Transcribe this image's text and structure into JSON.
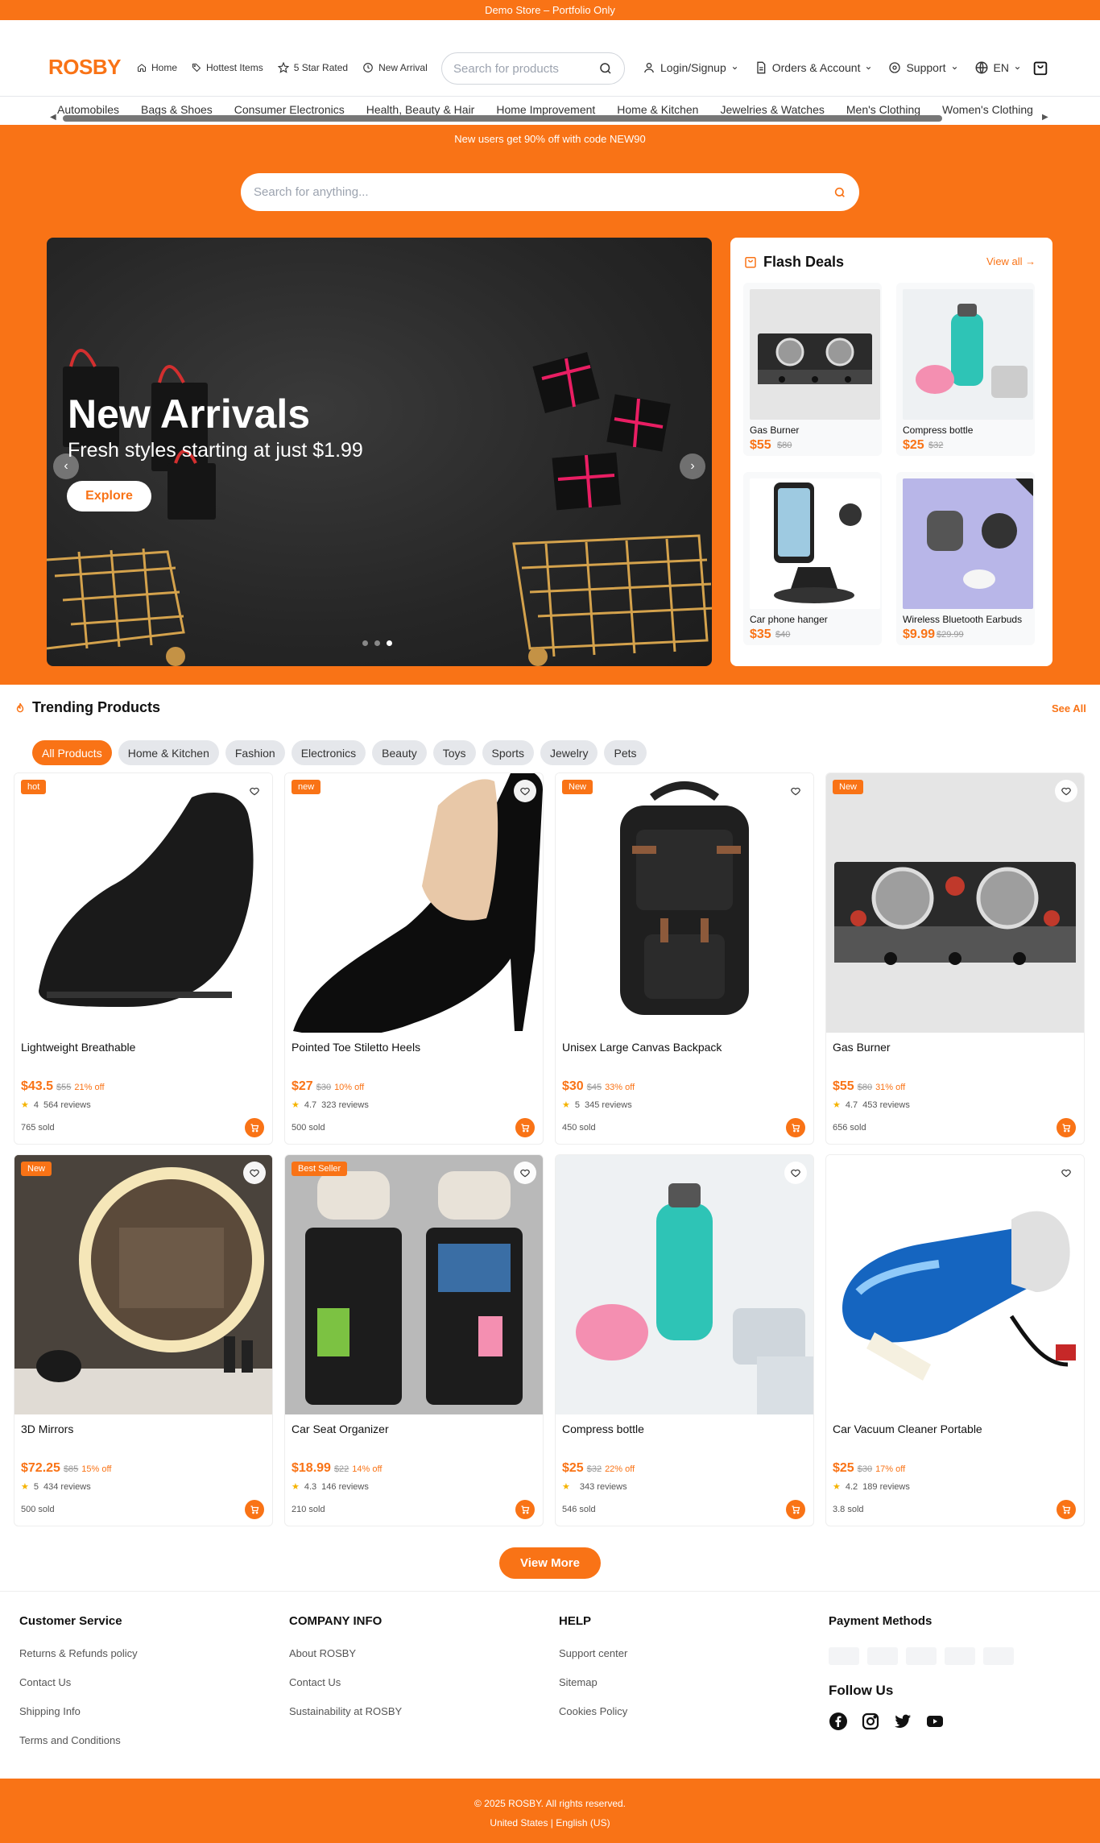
{
  "topbar": {
    "text": "Demo Store – Portfolio Only"
  },
  "header": {
    "logo": "ROSBY",
    "quick_links": [
      {
        "label": "Home",
        "icon": "home-icon"
      },
      {
        "label": "Hottest Items",
        "icon": "tag-icon"
      },
      {
        "label": "5 Star Rated",
        "icon": "star-icon"
      },
      {
        "label": "New Arrival",
        "icon": "clock-icon"
      }
    ],
    "search_placeholder": "Search for products",
    "account": {
      "login": "Login/Signup",
      "orders": "Orders & Account",
      "support": "Support",
      "lang": "EN"
    }
  },
  "categories": [
    "Automobiles",
    "Bags & Shoes",
    "Consumer Electronics",
    "Health, Beauty & Hair",
    "Home Improvement",
    "Home & Kitchen",
    "Jewelries & Watches",
    "Men's Clothing",
    "Women's Clothing"
  ],
  "promo": {
    "text": "New users get 90% off with code NEW90",
    "search_placeholder": "Search for anything..."
  },
  "hero": {
    "title": "New Arrivals",
    "subtitle": "Fresh styles starting at just $1.99",
    "button": "Explore",
    "slides": 3,
    "active_slide": 3
  },
  "flash_deals": {
    "title": "Flash Deals",
    "view_all": "View all",
    "items": [
      {
        "name": "Gas Burner",
        "price": "$55",
        "old": "$80"
      },
      {
        "name": "Compress bottle",
        "price": "$25",
        "old": "$32"
      },
      {
        "name": "Car phone hanger",
        "price": "$35",
        "old": "$40"
      },
      {
        "name": "Wireless Bluetooth Earbuds",
        "price": "$9.99",
        "old": "$29.99"
      }
    ]
  },
  "trending": {
    "title": "Trending Products",
    "see_all": "See All",
    "filters": [
      "All Products",
      "Home & Kitchen",
      "Fashion",
      "Electronics",
      "Beauty",
      "Toys",
      "Sports",
      "Jewelry",
      "Pets"
    ],
    "active_filter": "All Products",
    "products": [
      {
        "badge": "hot",
        "name": "Lightweight Breathable",
        "price": "$43.5",
        "old": "$55",
        "off": "21% off",
        "rating": "4",
        "reviews": "564 reviews",
        "sold": "765 sold"
      },
      {
        "badge": "new",
        "name": "Pointed Toe Stiletto Heels",
        "price": "$27",
        "old": "$30",
        "off": "10% off",
        "rating": "4.7",
        "reviews": "323 reviews",
        "sold": "500 sold"
      },
      {
        "badge": "New",
        "name": "Unisex Large Canvas Backpack",
        "price": "$30",
        "old": "$45",
        "off": "33% off",
        "rating": "5",
        "reviews": "345 reviews",
        "sold": "450 sold"
      },
      {
        "badge": "New",
        "name": "Gas Burner",
        "price": "$55",
        "old": "$80",
        "off": "31% off",
        "rating": "4.7",
        "reviews": "453 reviews",
        "sold": "656 sold"
      },
      {
        "badge": "New",
        "name": "3D Mirrors",
        "price": "$72.25",
        "old": "$85",
        "off": "15% off",
        "rating": "5",
        "reviews": "434 reviews",
        "sold": "500 sold"
      },
      {
        "badge": "Best Seller",
        "name": "Car Seat Organizer",
        "price": "$18.99",
        "old": "$22",
        "off": "14% off",
        "rating": "4.3",
        "reviews": "146 reviews",
        "sold": "210 sold"
      },
      {
        "badge": "",
        "name": "Compress bottle",
        "price": "$25",
        "old": "$32",
        "off": "22% off",
        "rating": "",
        "reviews": "343 reviews",
        "sold": "546 sold"
      },
      {
        "badge": "",
        "name": "Car Vacuum Cleaner Portable",
        "price": "$25",
        "old": "$30",
        "off": "17% off",
        "rating": "4.2",
        "reviews": "189 reviews",
        "sold": "3.8 sold"
      }
    ],
    "view_more": "View More"
  },
  "footer": {
    "customer_service": {
      "title": "Customer Service",
      "links": [
        "Returns & Refunds policy",
        "Contact Us",
        "Shipping Info",
        "Terms and Conditions"
      ]
    },
    "company": {
      "title": "COMPANY INFO",
      "links": [
        "About ROSBY",
        "Contact Us",
        "Sustainability at ROSBY"
      ]
    },
    "help": {
      "title": "HELP",
      "links": [
        "Support center",
        "Sitemap",
        "Cookies Policy"
      ]
    },
    "payment": {
      "title": "Payment Methods",
      "follow": "Follow Us",
      "social": [
        "facebook-icon",
        "instagram-icon",
        "twitter-icon",
        "youtube-icon"
      ]
    },
    "copyright": "© 2025 ROSBY. All rights reserved.",
    "locale": "United States | English (US)"
  },
  "colors": {
    "accent": "#f97316"
  }
}
